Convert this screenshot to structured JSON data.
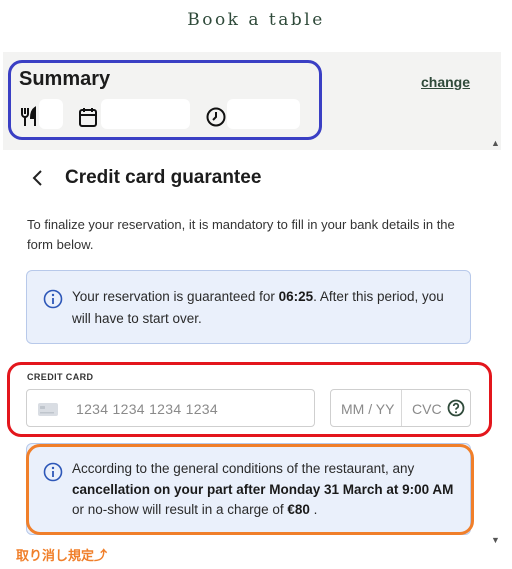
{
  "page": {
    "title": "Book a table"
  },
  "summary": {
    "title": "Summary",
    "change_label": "change",
    "icons": [
      "fork-knife-icon",
      "calendar-icon",
      "clock-icon"
    ],
    "guests_value": "",
    "date_value": "",
    "time_value": ""
  },
  "section": {
    "title": "Credit card guarantee"
  },
  "intro": {
    "text": "To finalize your reservation, it is mandatory to fill in your bank details in the form below."
  },
  "timer_notice": {
    "prefix": "Your reservation is guaranteed for ",
    "time": "06:25",
    "suffix": ". After this period, you will have to start over."
  },
  "credit_card": {
    "label": "CREDIT CARD",
    "number_placeholder": "1234 1234 1234 1234",
    "expiry_placeholder": "MM / YY",
    "cvc_placeholder": "CVC"
  },
  "cancellation": {
    "prefix": "According to the general conditions of the restaurant, any ",
    "bold1": "cancellation on your part after Monday 31 March at 9:00 AM",
    "middle": " or no-show will result in a charge of ",
    "amount": "€80",
    "suffix": " ."
  },
  "annotation": {
    "note": "取り消し規定⤴"
  },
  "colors": {
    "accent_green": "#2f4a3a",
    "info_bg": "#eaf0fb",
    "info_icon": "#2d57b8",
    "annotation_blue": "#3a3fc4",
    "annotation_red": "#e3161c",
    "annotation_orange": "#f07f2a"
  }
}
